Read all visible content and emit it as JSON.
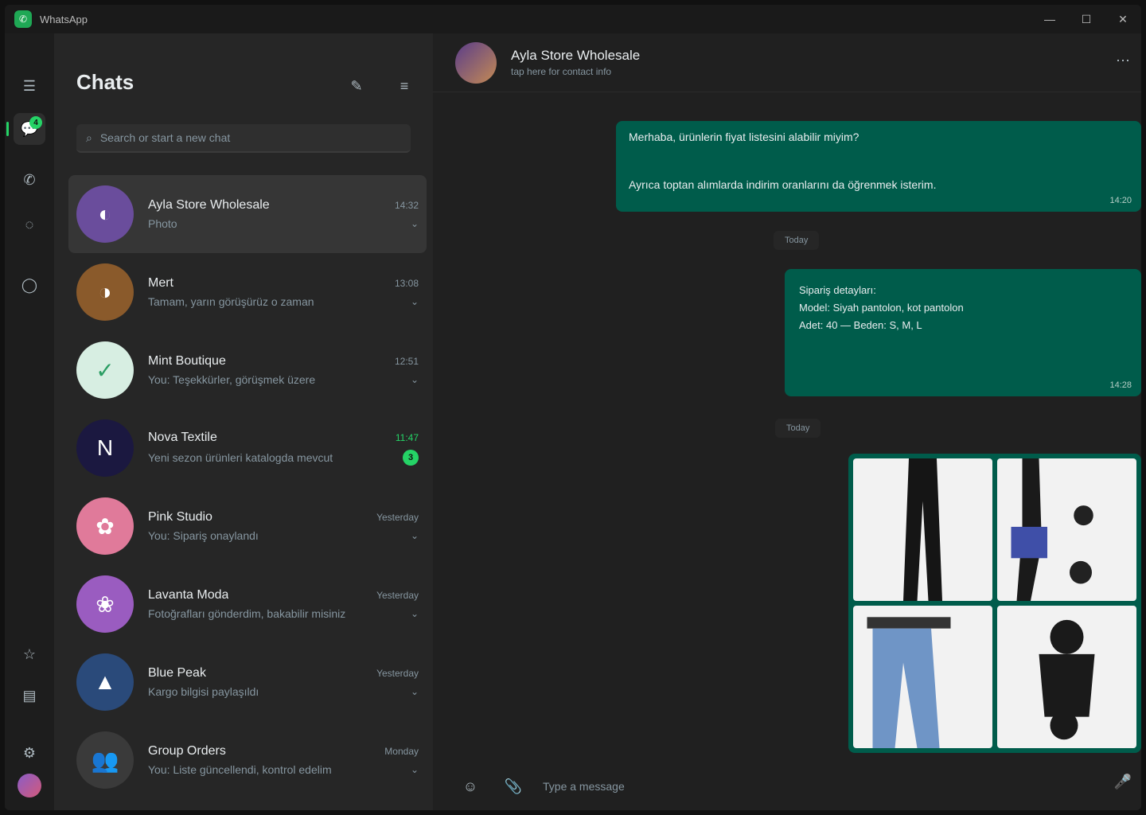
{
  "app": {
    "title": "WhatsApp",
    "logo_glyph": "✆"
  },
  "window_controls": {
    "minimize": "—",
    "maximize": "☐",
    "close": "✕"
  },
  "rail": {
    "menu_glyph": "☰",
    "chats_glyph": "💬",
    "chats_badge": "4",
    "calls_glyph": "✆",
    "status_glyph": "◌",
    "meta_glyph": "◯",
    "starred_glyph": "☆",
    "archive_glyph": "▤",
    "settings_glyph": "⚙"
  },
  "sidebar": {
    "title": "Chats",
    "new_chat_glyph": "✎",
    "filter_glyph": "≡",
    "search_placeholder": "Search or start a new chat",
    "chats": [
      {
        "name": "Ayla Store Wholesale",
        "time": "14:32",
        "preview": "Photo",
        "color": "#6a4d9c",
        "glyph": "◐",
        "selected": true,
        "unread": ""
      },
      {
        "name": "Mert",
        "time": "13:08",
        "preview": "Tamam, yarın görüşürüz o zaman",
        "color": "#8a5a2b",
        "glyph": "◑",
        "selected": false,
        "unread": ""
      },
      {
        "name": "Mint Boutique",
        "time": "12:51",
        "preview": "You: Teşekkürler, görüşmek üzere",
        "color": "#d7eee2",
        "glyph": "✓",
        "selected": false,
        "unread": ""
      },
      {
        "name": "Nova Textile",
        "time": "11:47",
        "preview": "Yeni sezon ürünleri katalogda mevcut",
        "color": "#1b1840",
        "glyph": "N",
        "selected": false,
        "unread": "3"
      },
      {
        "name": "Pink Studio",
        "time": "Yesterday",
        "preview": "You: Sipariş onaylandı",
        "color": "#e07a9a",
        "glyph": "✿",
        "selected": false,
        "unread": ""
      },
      {
        "name": "Lavanta Moda",
        "time": "Yesterday",
        "preview": "Fotoğrafları gönderdim, bakabilir misiniz",
        "color": "#9a5cc0",
        "glyph": "❀",
        "selected": false,
        "unread": ""
      },
      {
        "name": "Blue Peak",
        "time": "Yesterday",
        "preview": "Kargo bilgisi paylaşıldı",
        "color": "#2a4a7a",
        "glyph": "▲",
        "selected": false,
        "unread": ""
      },
      {
        "name": "Group Orders",
        "time": "Monday",
        "preview": "You: Liste güncellendi, kontrol edelim",
        "color": "#3a3a3a",
        "glyph": "👥",
        "selected": false,
        "unread": ""
      }
    ]
  },
  "conversation": {
    "name": "Ayla Store Wholesale",
    "subtitle": "tap here for contact info",
    "menu_glyph": "⋯",
    "messages": {
      "m1_line1": "Merhaba, ürünlerin fiyat listesini alabilir miyim?",
      "m1_line2": "Ayrıca toptan alımlarda indirim oranlarını da öğrenmek isterim.",
      "m1_time": "14:20",
      "date_1": "Today",
      "m2_line1": "Sipariş detayları:",
      "m2_line2": "Model: Siyah pantolon, kot pantolon",
      "m2_line3": "Adet: 40 — Beden: S, M, L",
      "m2_time": "14:28",
      "date_2": "Today"
    },
    "composer": {
      "emoji_glyph": "☺",
      "attach_glyph": "📎",
      "placeholder": "Type a message",
      "mic_glyph": "🎤"
    }
  }
}
